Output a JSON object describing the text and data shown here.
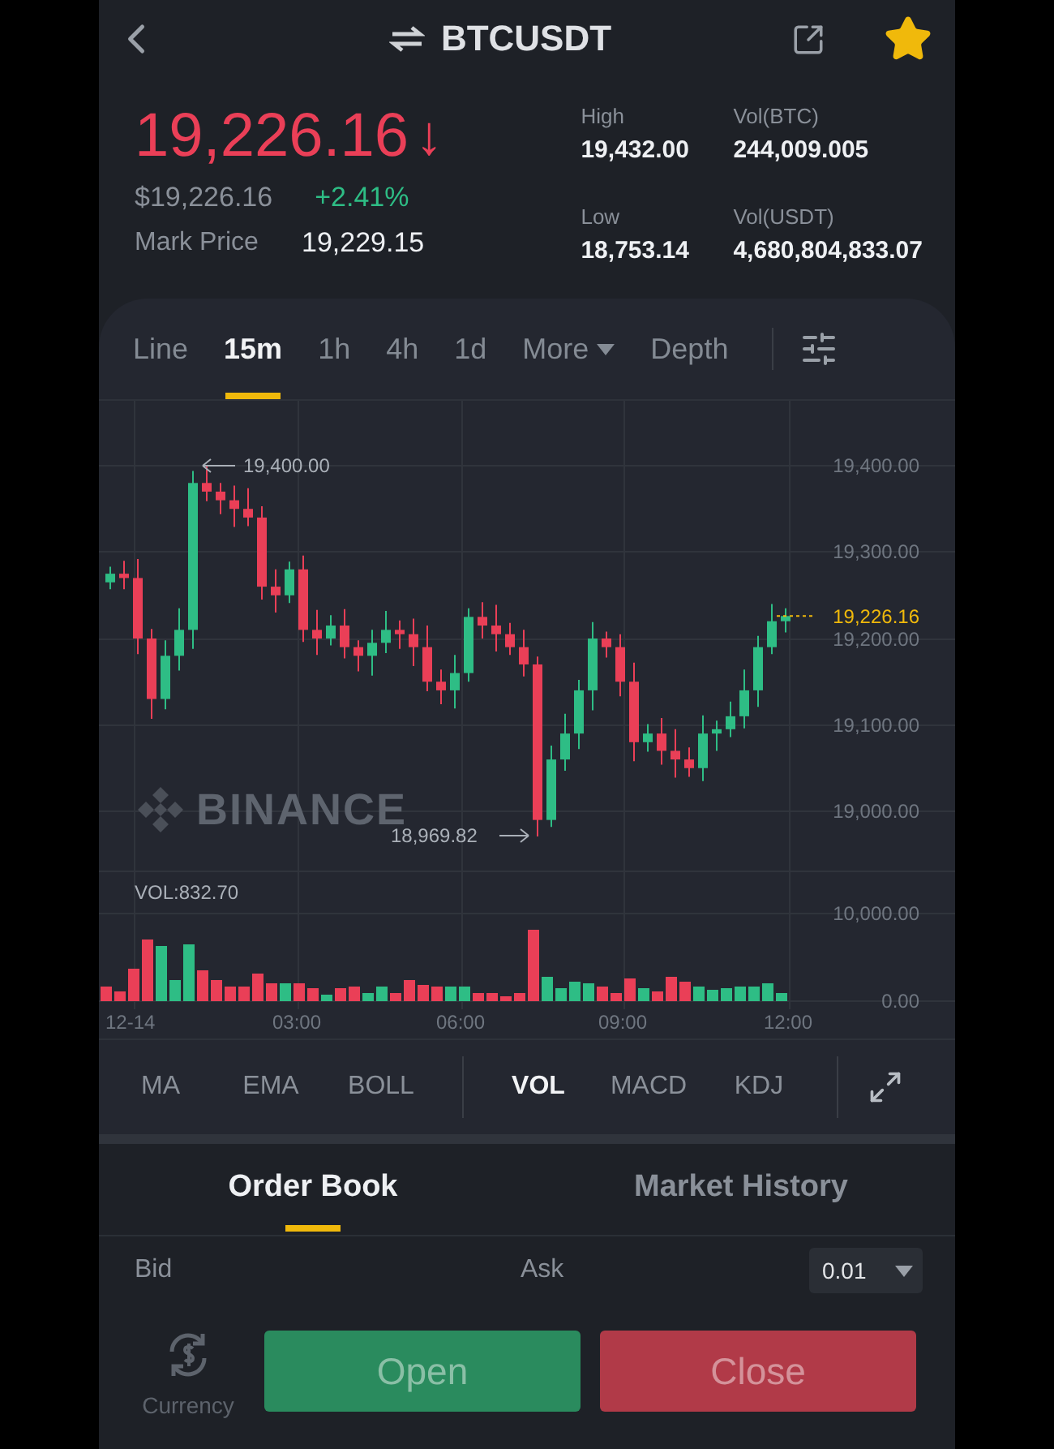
{
  "header": {
    "title": "BTCUSDT",
    "favorite": true
  },
  "ticker": {
    "last_price": "19,226.16",
    "falling": true,
    "arrow": "↓",
    "usd_price": "$19,226.16",
    "change": "+2.41%",
    "mark_price_label": "Mark Price",
    "mark_price": "19,229.15",
    "stats": [
      {
        "label": "High",
        "value": "19,432.00"
      },
      {
        "label": "Vol(BTC)",
        "value": "244,009.005"
      },
      {
        "label": "Low",
        "value": "18,753.14"
      },
      {
        "label": "Vol(USDT)",
        "value": "4,680,804,833.07"
      }
    ]
  },
  "interval_tabs": [
    {
      "label": "Line",
      "kind": "tab",
      "selected": false
    },
    {
      "label": "15m",
      "kind": "tab",
      "selected": true
    },
    {
      "label": "1h",
      "kind": "tab",
      "selected": false
    },
    {
      "label": "4h",
      "kind": "tab",
      "selected": false
    },
    {
      "label": "1d",
      "kind": "tab",
      "selected": false
    },
    {
      "label": "More",
      "kind": "dropdown",
      "selected": false
    },
    {
      "label": "Depth",
      "kind": "tab",
      "selected": false
    }
  ],
  "chart": {
    "price_labels": [
      "19,400.00",
      "19,300.00",
      "19,200.00",
      "19,100.00",
      "19,000.00"
    ],
    "current_price": "19,226.16",
    "high_marker": "19,400.00",
    "low_marker": "18,969.82",
    "watermark": "BINANCE",
    "volume_label": "VOL:832.70",
    "volume_labels": [
      "10,000.00",
      "0.00"
    ],
    "time_labels": [
      "12-14",
      "03:00",
      "06:00",
      "09:00",
      "12:00"
    ]
  },
  "indicators": {
    "main": [
      {
        "label": "MA",
        "selected": false
      },
      {
        "label": "EMA",
        "selected": false
      },
      {
        "label": "BOLL",
        "selected": false
      }
    ],
    "sub": [
      {
        "label": "VOL",
        "selected": true
      },
      {
        "label": "MACD",
        "selected": false
      },
      {
        "label": "KDJ",
        "selected": false
      }
    ]
  },
  "order_tabs": [
    {
      "label": "Order Book",
      "selected": true
    },
    {
      "label": "Market History",
      "selected": false
    }
  ],
  "book_header": {
    "bid": "Bid",
    "ask": "Ask",
    "precision": "0.01"
  },
  "footer": {
    "currency_label": "Currency",
    "buttons": [
      {
        "label": "Open",
        "kind": "buy",
        "disabled": true
      },
      {
        "label": "Close",
        "kind": "sell",
        "disabled": true
      }
    ]
  }
}
